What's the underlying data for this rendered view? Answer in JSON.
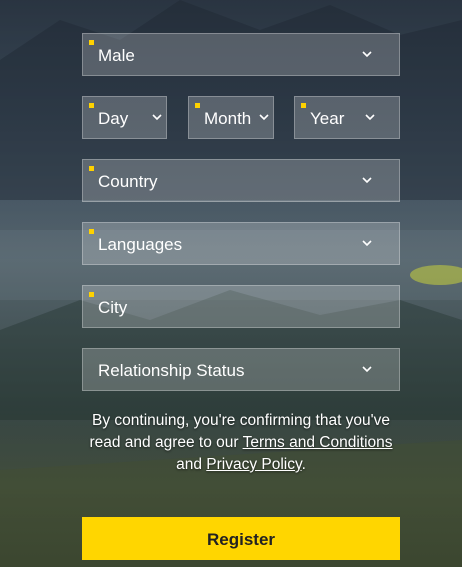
{
  "form": {
    "gender": {
      "value": "Male",
      "required": true
    },
    "day": {
      "value": "Day",
      "required": true
    },
    "month": {
      "value": "Month",
      "required": true
    },
    "year": {
      "value": "Year",
      "required": true
    },
    "country": {
      "value": "Country",
      "required": true
    },
    "languages": {
      "value": "Languages",
      "required": true
    },
    "city": {
      "placeholder": "City",
      "required": true
    },
    "relationship": {
      "value": "Relationship Status",
      "required": false
    }
  },
  "terms": {
    "prefix": "By continuing, you're confirming that you've read and agree to our",
    "terms_link": "Terms and Conditions",
    "and": "and",
    "privacy_link": "Privacy Policy",
    "suffix": "."
  },
  "register_label": "Register",
  "colors": {
    "accent": "#ffd600",
    "required_marker": "#ffd200",
    "text": "#ffffff"
  },
  "icons": {
    "dropdown": "chevron-down-icon"
  }
}
